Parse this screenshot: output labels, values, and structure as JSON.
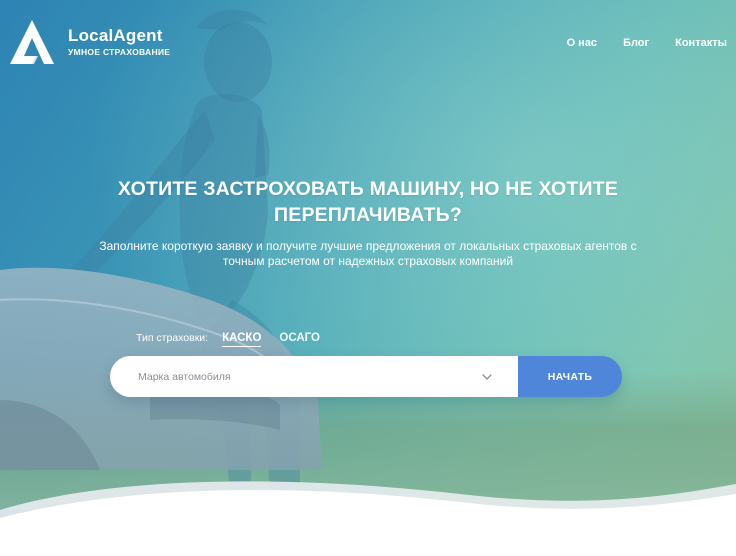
{
  "brand": {
    "name": "LocalAgent",
    "tagline": "УМНОЕ СТРАХОВАНИЕ",
    "logo_icon": "letter-a-triangle-logo"
  },
  "nav": {
    "items": [
      {
        "label": "О нас"
      },
      {
        "label": "Блог"
      },
      {
        "label": "Контакты"
      }
    ]
  },
  "hero": {
    "headline_line1": "ХОТИТЕ ЗАСТРОХОВАТЬ МАШИНУ, НО НЕ ХОТИТЕ",
    "headline_line2": "ПЕРЕПЛАЧИВАТЬ?",
    "subtitle_line1": "Заполните короткую заявку и получите лучшие предложения от локальных страховых агентов с",
    "subtitle_line2": "точным расчетом от надежных страховых компаний"
  },
  "insurance_type": {
    "label": "Тип страховки:",
    "options": [
      {
        "label": "КАСКО",
        "selected": true
      },
      {
        "label": "ОСАГО",
        "selected": false
      }
    ]
  },
  "search": {
    "car_brand_placeholder": "Марка автомобиля",
    "dropdown_icon": "chevron-down-icon",
    "start_label": "НАЧАТЬ"
  },
  "colors": {
    "accent": "#4f86d9",
    "hero_gradient_start": "#2f86b6",
    "hero_gradient_end": "#8fc7a0",
    "text_on_hero": "#ffffff"
  }
}
